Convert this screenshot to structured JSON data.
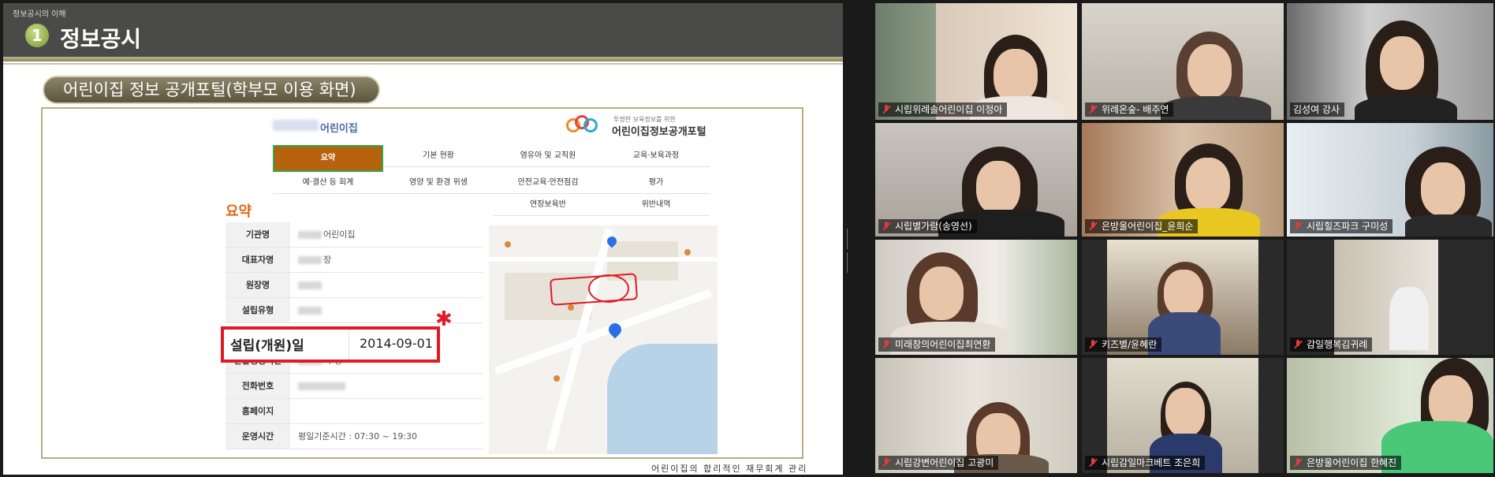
{
  "slide": {
    "breadcrumb": "정보공시의 이해",
    "number": "1",
    "title": "정보공시",
    "section_label": "어린이집 정보 공개포털(학부모 이용 화면)",
    "footer": "어린이집의 합리적인 재무회계 관리"
  },
  "portal": {
    "daycare_name": "어린이집",
    "logo_subtitle": "투명한 보육정보를 위한",
    "logo_title": "어린이집정보공개포털",
    "tabs": [
      "요약",
      "기본 현황",
      "영유아 및 교직원",
      "교육·보육과정",
      "예·결산 등 회계",
      "영양 및 환경 위생",
      "안전교육·안전점검",
      "평가",
      "연장보육반",
      "위반내역"
    ],
    "summary_title": "요약",
    "rows": [
      {
        "label": "기관명",
        "value": "어린이집"
      },
      {
        "label": "대표자명",
        "value": "장"
      },
      {
        "label": "원장명",
        "value": ""
      },
      {
        "label": "설립유형",
        "value": ""
      },
      {
        "label": "관할행정기관",
        "value": "시 청"
      },
      {
        "label": "전화번호",
        "value": ""
      },
      {
        "label": "홈페이지",
        "value": ""
      },
      {
        "label": "운영시간",
        "value": "평일기준시간 : 07:30 ~ 19:30"
      }
    ],
    "callout": {
      "label": "설립(개원)일",
      "value": "2014-09-01"
    }
  },
  "participants": [
    {
      "name": "시립위례솔어린이집 이정아",
      "muted": true,
      "active": false
    },
    {
      "name": "위례온숲- 배주연",
      "muted": true,
      "active": false
    },
    {
      "name": "김성여 강사",
      "muted": false,
      "active": true
    },
    {
      "name": "시립별가람(송영선)",
      "muted": true,
      "active": false
    },
    {
      "name": "은방울어린이집_윤희순",
      "muted": true,
      "active": false
    },
    {
      "name": "시립힐즈파크 구미성",
      "muted": true,
      "active": false
    },
    {
      "name": "미래창의어린이집최연환",
      "muted": true,
      "active": false
    },
    {
      "name": "키즈별/윤혜란",
      "muted": true,
      "active": false
    },
    {
      "name": "감일행복김귀례",
      "muted": true,
      "active": false
    },
    {
      "name": "시립강변어린이집 고광미",
      "muted": true,
      "active": false
    },
    {
      "name": "시립감일마크베트 조은희",
      "muted": true,
      "active": false
    },
    {
      "name": "은방울어린이집 한혜진",
      "muted": true,
      "active": false
    }
  ],
  "colors": {
    "active_tab": "#b7620f",
    "active_tab_border": "#2fa64a",
    "annotation_red": "#e01b24",
    "active_speaker": "#d7e06a",
    "summary_orange": "#e06a1a"
  }
}
